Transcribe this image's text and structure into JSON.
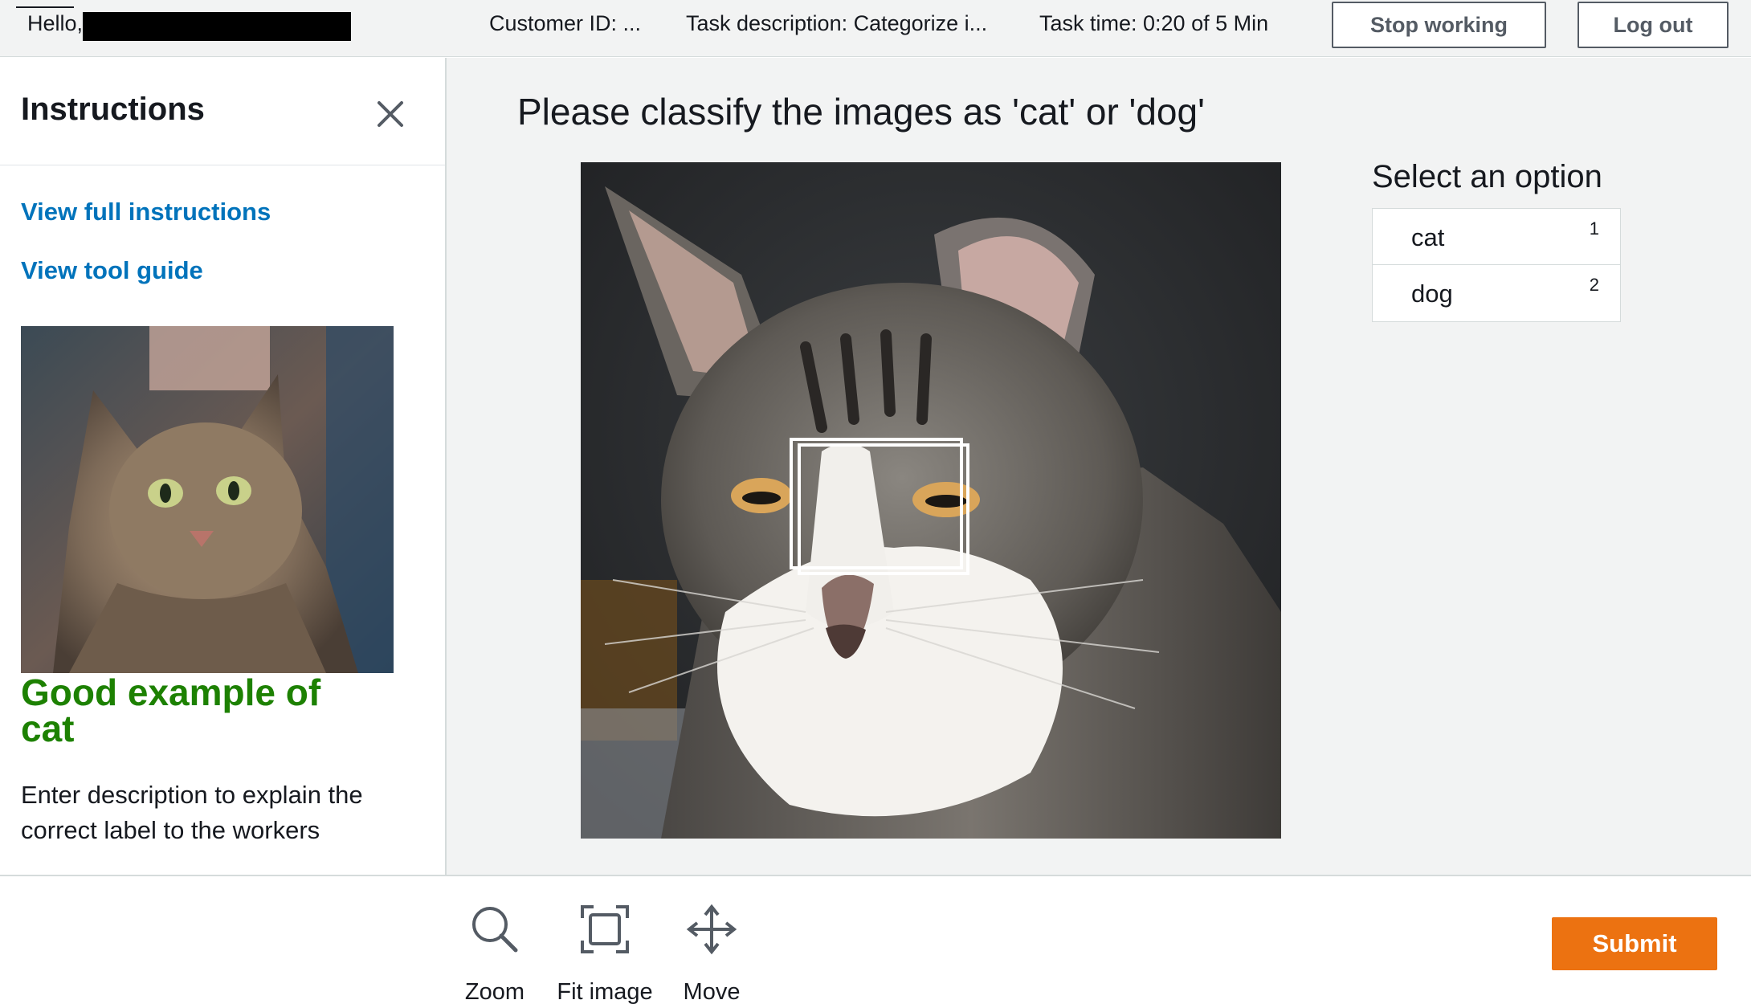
{
  "header": {
    "greeting": "Hello,",
    "customer_id": "Customer ID: ...",
    "task_description": "Task description: Categorize i...",
    "task_time": "Task time: 0:20 of 5 Min",
    "stop_label": "Stop working",
    "logout_label": "Log out"
  },
  "sidebar": {
    "title": "Instructions",
    "close_icon": "close-icon",
    "links": [
      "View full instructions",
      "View tool guide"
    ],
    "example": {
      "title": "Good example of cat",
      "description": "Enter description to explain the correct label to the workers"
    }
  },
  "main": {
    "prompt": "Please classify the images as 'cat' or 'dog'",
    "options_title": "Select an option",
    "options": [
      {
        "label": "cat",
        "key": "1"
      },
      {
        "label": "dog",
        "key": "2"
      }
    ]
  },
  "toolbar": {
    "tools": [
      {
        "label": "Zoom",
        "icon": "magnifier-icon"
      },
      {
        "label": "Fit image",
        "icon": "fit-image-icon"
      },
      {
        "label": "Move",
        "icon": "move-arrows-icon"
      }
    ],
    "submit_label": "Submit"
  },
  "colors": {
    "link": "#0073bb",
    "good_example": "#1d8102",
    "submit": "#ec7211",
    "topbar_bg": "#f2f3f3"
  }
}
